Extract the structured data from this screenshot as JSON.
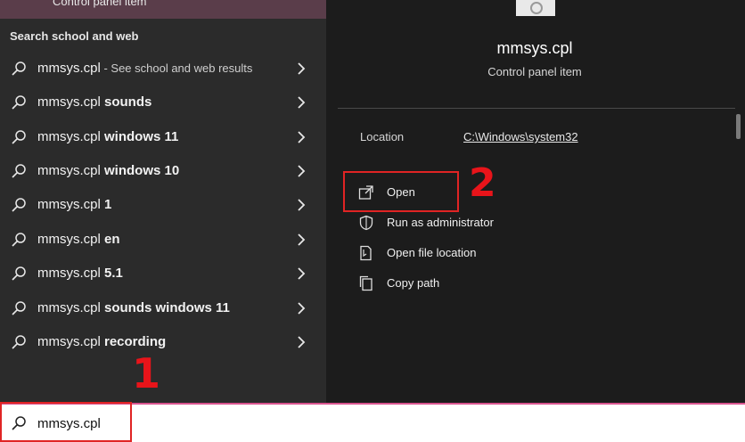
{
  "left_panel": {
    "top_item_label": "Control panel item",
    "section_title": "Search school and web",
    "results": [
      {
        "base": "mmsys.cpl",
        "bold": "",
        "suffix": " - See school and web results"
      },
      {
        "base": "mmsys.cpl ",
        "bold": "sounds",
        "suffix": ""
      },
      {
        "base": "mmsys.cpl ",
        "bold": "windows 11",
        "suffix": ""
      },
      {
        "base": "mmsys.cpl ",
        "bold": "windows 10",
        "suffix": ""
      },
      {
        "base": "mmsys.cpl ",
        "bold": "1",
        "suffix": ""
      },
      {
        "base": "mmsys.cpl ",
        "bold": "en",
        "suffix": ""
      },
      {
        "base": "mmsys.cpl ",
        "bold": "5.1",
        "suffix": ""
      },
      {
        "base": "mmsys.cpl ",
        "bold": "sounds windows 11",
        "suffix": ""
      },
      {
        "base": "mmsys.cpl ",
        "bold": "recording",
        "suffix": ""
      }
    ]
  },
  "right_panel": {
    "app_name": "mmsys.cpl",
    "app_type": "Control panel item",
    "location_label": "Location",
    "location_value": "C:\\Windows\\system32",
    "actions": [
      {
        "label": "Open",
        "icon": "open-icon"
      },
      {
        "label": "Run as administrator",
        "icon": "shield-icon"
      },
      {
        "label": "Open file location",
        "icon": "file-location-icon"
      },
      {
        "label": "Copy path",
        "icon": "copy-icon"
      }
    ]
  },
  "search_bar": {
    "value": "mmsys.cpl"
  },
  "annotations": {
    "step1": "1",
    "step2": "2"
  },
  "colors": {
    "accent_border": "#d9548f",
    "annotation_red": "#e02424",
    "panel_left": "#2b2b2b",
    "panel_right": "#1c1c1c"
  }
}
